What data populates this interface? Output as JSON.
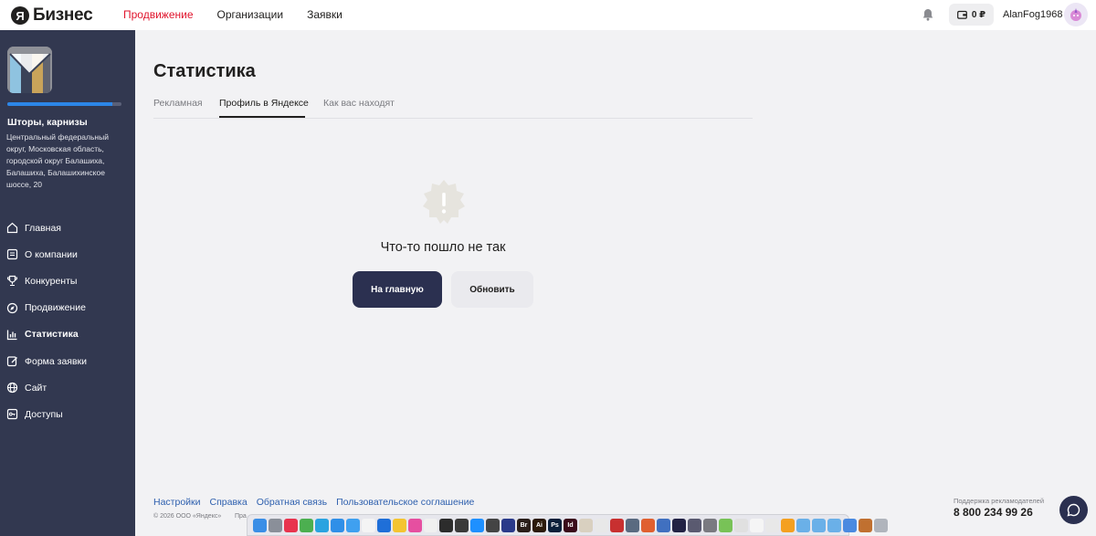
{
  "header": {
    "logo_letter": "Я",
    "logo_text": "Бизнес",
    "nav": [
      {
        "label": "Продвижение",
        "active": true
      },
      {
        "label": "Организации",
        "active": false
      },
      {
        "label": "Заявки",
        "active": false
      }
    ],
    "balance": "0 ₽",
    "username": "AlanFog1968",
    "accent_color": "#e0142c"
  },
  "sidebar": {
    "company_name": "Шторы, карнизы",
    "company_address": "Центральный федеральный округ, Московская область, городской округ Балашиха, Балашиха, Балашихинское шоссе, 20",
    "profile_progress": 0.92,
    "menu": [
      {
        "label": "Главная",
        "icon": "home-icon",
        "active": false
      },
      {
        "label": "О компании",
        "icon": "document-icon",
        "active": false
      },
      {
        "label": "Конкуренты",
        "icon": "trophy-icon",
        "active": false
      },
      {
        "label": "Продвижение",
        "icon": "compass-icon",
        "active": false
      },
      {
        "label": "Статистика",
        "icon": "chart-icon",
        "active": true
      },
      {
        "label": "Форма заявки",
        "icon": "edit-icon",
        "active": false
      },
      {
        "label": "Сайт",
        "icon": "globe-icon",
        "active": false
      },
      {
        "label": "Доступы",
        "icon": "key-icon",
        "active": false
      }
    ]
  },
  "main": {
    "title": "Статистика",
    "tabs": [
      {
        "label": "Рекламная",
        "active": false
      },
      {
        "label": "Профиль в Яндексе",
        "active": true
      },
      {
        "label": "Как вас находят",
        "active": false
      }
    ],
    "error": {
      "message": "Что-то пошло не так",
      "primary_button": "На главную",
      "secondary_button": "Обновить"
    }
  },
  "footer": {
    "links": [
      "Настройки",
      "Справка",
      "Обратная связь",
      "Пользовательское соглашение"
    ],
    "copyright": "© 2026 ООО «Яндекс»",
    "copyright_tail": "Пра",
    "support_label": "Поддержка рекламодателей",
    "support_phone": "8 800 234 99 26"
  },
  "dock": {
    "icons": [
      {
        "name": "finder-icon",
        "color": "#3a8ee6",
        "glyph": ""
      },
      {
        "name": "launchpad-icon",
        "color": "#8a8f99",
        "glyph": ""
      },
      {
        "name": "music-app-icon",
        "color": "#e8344e",
        "glyph": ""
      },
      {
        "name": "chrome-icon",
        "color": "#4caf50",
        "glyph": ""
      },
      {
        "name": "telegram-icon",
        "color": "#2aa3e0",
        "glyph": ""
      },
      {
        "name": "safari-icon",
        "color": "#2f8fe8",
        "glyph": ""
      },
      {
        "name": "mail-icon",
        "color": "#3fa0f0",
        "glyph": ""
      },
      {
        "name": "calendar-icon",
        "color": "#f4f4f4",
        "glyph": ""
      },
      {
        "name": "browser-icon",
        "color": "#1f6fd8",
        "glyph": ""
      },
      {
        "name": "notes-icon",
        "color": "#f4c430",
        "glyph": ""
      },
      {
        "name": "itunes-icon",
        "color": "#e64fa0",
        "glyph": ""
      },
      {
        "name": "photos-icon",
        "color": "#f0f0f0",
        "glyph": ""
      },
      {
        "name": "terminal-icon",
        "color": "#2c2c2c",
        "glyph": ""
      },
      {
        "name": "activity-icon",
        "color": "#3a3a3a",
        "glyph": ""
      },
      {
        "name": "appstore-icon",
        "color": "#1e90ff",
        "glyph": ""
      },
      {
        "name": "camera-icon",
        "color": "#444444",
        "glyph": ""
      },
      {
        "name": "vpn-icon",
        "color": "#2a3a8a",
        "glyph": ""
      },
      {
        "name": "bridge-icon",
        "color": "#2a1f1a",
        "glyph": "Br"
      },
      {
        "name": "illustrator-icon",
        "color": "#2b1a0a",
        "glyph": "Ai"
      },
      {
        "name": "photoshop-icon",
        "color": "#0a1f3a",
        "glyph": "Ps"
      },
      {
        "name": "indesign-icon",
        "color": "#3a0a1a",
        "glyph": "Id"
      },
      {
        "name": "preview-icon",
        "color": "#d9d0c0",
        "glyph": ""
      },
      {
        "name": "scripts-icon",
        "color": "#e8e8e8",
        "glyph": ""
      },
      {
        "name": "printer-icon",
        "color": "#c83030",
        "glyph": ""
      },
      {
        "name": "scanner-icon",
        "color": "#5a6a80",
        "glyph": ""
      },
      {
        "name": "color-icon",
        "color": "#e06030",
        "glyph": ""
      },
      {
        "name": "dictionary-icon",
        "color": "#4070c0",
        "glyph": ""
      },
      {
        "name": "obs-icon",
        "color": "#222244",
        "glyph": ""
      },
      {
        "name": "screenshot-icon",
        "color": "#5a5a70",
        "glyph": ""
      },
      {
        "name": "settings-icon",
        "color": "#7a7a80",
        "glyph": ""
      },
      {
        "name": "android-icon",
        "color": "#78c257",
        "glyph": ""
      },
      {
        "name": "paintbrush-icon",
        "color": "#e0e0e0",
        "glyph": ""
      },
      {
        "name": "textedit-icon",
        "color": "#f5f5f5",
        "glyph": ""
      },
      {
        "name": "pen-icon",
        "color": "#e8e8e8",
        "glyph": ""
      },
      {
        "name": "sketch-icon",
        "color": "#f4a020",
        "glyph": ""
      },
      {
        "name": "folder-icon",
        "color": "#6ab0e8",
        "glyph": ""
      },
      {
        "name": "folder-icon",
        "color": "#6ab0e8",
        "glyph": ""
      },
      {
        "name": "folder-icon",
        "color": "#6ab0e8",
        "glyph": ""
      },
      {
        "name": "document-file-icon",
        "color": "#4a8ae0",
        "glyph": ""
      },
      {
        "name": "downloads-icon",
        "color": "#c07030",
        "glyph": ""
      },
      {
        "name": "trash-icon",
        "color": "#b0b4bc",
        "glyph": ""
      }
    ]
  }
}
